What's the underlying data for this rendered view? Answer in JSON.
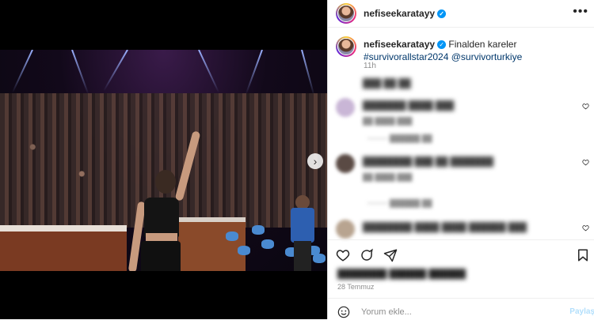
{
  "post": {
    "username": "nefiseekaratayy",
    "caption": "Finalden kareler",
    "hashtag": "#survivorallstar2024",
    "mention": "@survivorturkiye",
    "time_ago": "11h",
    "date": "28 Temmuz",
    "carousel": {
      "slides": 6,
      "active_index": 1
    }
  },
  "comments_redacted": [
    {
      "text": "███████ ████ ███",
      "meta": "██ ████ ███",
      "avatar_color": "#c9b6d6"
    },
    {
      "text": "████████ ███ ██ ███████",
      "meta": "██ ████ ███",
      "reply": "█████ ████",
      "avatar_color": "#f0c7d4"
    },
    {
      "text": "████████ ████ ████ ██████ ███",
      "meta": "██ ████ ███",
      "reply": "█████ ████",
      "avatar_color": "#5a4a44"
    },
    {
      "text": "██████ ███████ █████",
      "meta": "██ ████ ███ ███",
      "avatar_color": "#b8a490"
    }
  ],
  "likes_redacted": "████████ ██████ ██████",
  "composer": {
    "placeholder": "Yorum ekle...",
    "post_label": "Paylaş"
  },
  "colors": {
    "accent": "#0095f6",
    "link": "#00376b"
  },
  "icons": [
    "more-options-icon",
    "verified-badge-icon",
    "heart-icon",
    "comment-icon",
    "share-icon",
    "save-icon",
    "emoji-icon",
    "next-slide-icon"
  ]
}
